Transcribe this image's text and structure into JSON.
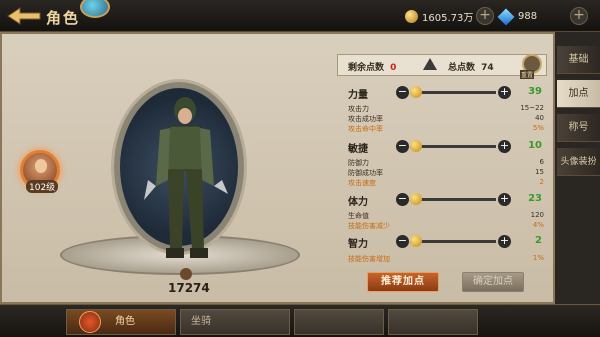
{
  "header": {
    "title": "角色",
    "gold_value": "1605.73万",
    "gem_value": "988"
  },
  "character": {
    "level": "102级",
    "power": "17274"
  },
  "points": {
    "remaining_label": "剩余点数",
    "remaining_value": "0",
    "total_label": "总点数",
    "total_value": "74",
    "reset_label": "重置"
  },
  "stats": {
    "strength": {
      "name": "力量",
      "value": "39",
      "level": 0.05,
      "subs": [
        {
          "k": "攻击力",
          "v": "15~22"
        },
        {
          "k": "攻击成功率",
          "v": "40"
        },
        {
          "k": "攻击命中率",
          "v": "5%"
        }
      ]
    },
    "agility": {
      "name": "敏捷",
      "value": "10",
      "level": 0.05,
      "subs": [
        {
          "k": "防御力",
          "v": "6"
        },
        {
          "k": "防御成功率",
          "v": "15"
        },
        {
          "k": "攻击速度",
          "v": "2"
        }
      ]
    },
    "stamina": {
      "name": "体力",
      "value": "23",
      "level": 0.05,
      "subs": [
        {
          "k": "生命值",
          "v": "120"
        },
        {
          "k": "技能伤害减少",
          "v": "4%"
        }
      ]
    },
    "intelligence": {
      "name": "智力",
      "value": "2",
      "level": 0.05,
      "subs": [
        {
          "k": "技能伤害增加",
          "v": "1%"
        }
      ]
    }
  },
  "buttons": {
    "recommend": "推荐加点",
    "confirm": "确定加点"
  },
  "side_tabs": [
    "基础",
    "加点",
    "称号",
    "头像装扮"
  ],
  "bottom_tabs": [
    "角色",
    "坐骑"
  ],
  "colors": {
    "accent": "#c8642a",
    "stat_value": "#3a9a2a",
    "highlight_sub": "#c86a10"
  }
}
